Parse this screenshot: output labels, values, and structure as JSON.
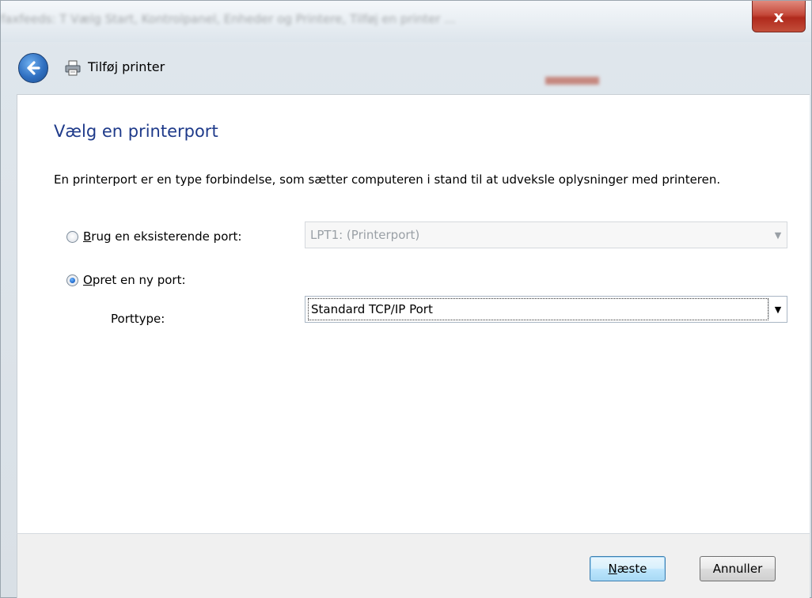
{
  "window": {
    "blurred_title": "faxfeeds: T Vælg Start, Kontrolpanel, Enheder og Printere, Tilføj en printer ...",
    "close_label": "x"
  },
  "header": {
    "title": "Tilføj printer",
    "back_icon": "back-arrow-icon",
    "printer_icon": "printer-icon"
  },
  "content": {
    "heading": "Vælg en printerport",
    "description": "En printerport er en type forbindelse, som sætter computeren i stand til at udveksle oplysninger med printeren.",
    "options": {
      "existing": {
        "label_first": "B",
        "label_rest": "rug en eksisterende port:",
        "selected": false,
        "combo_value": "LPT1: (Printerport)"
      },
      "new": {
        "label_first": "O",
        "label_rest": "pret en ny port:",
        "selected": true
      }
    },
    "porttype": {
      "label": "Porttype:",
      "value": "Standard TCP/IP Port"
    }
  },
  "footer": {
    "next_first": "N",
    "next_rest": "æste",
    "cancel": "Annuller"
  },
  "colors": {
    "heading": "#1e3a8a",
    "close_button": "#c5493a",
    "primary_button_border": "#3c7fb1"
  }
}
